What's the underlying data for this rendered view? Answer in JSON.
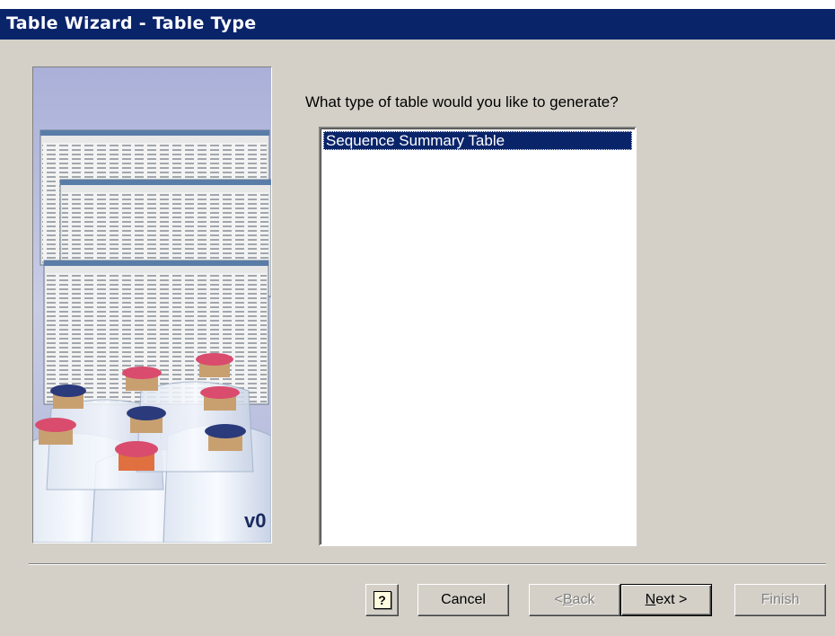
{
  "window": {
    "title": "Table Wizard - Table Type"
  },
  "prompt": "What type of table would you like to generate?",
  "table_types": [
    {
      "label": "Sequence Summary Table",
      "selected": true
    }
  ],
  "buttons": {
    "help_icon": "help-icon",
    "cancel": "Cancel",
    "back_prefix": "< ",
    "back_mnemonic": "B",
    "back_rest": "ack",
    "next_mnemonic": "N",
    "next_rest": "ext >",
    "finish": "Finish"
  },
  "colors": {
    "titlebar": "#0a246a",
    "dialog_face": "#d4d0c8",
    "selection": "#0a246a"
  }
}
